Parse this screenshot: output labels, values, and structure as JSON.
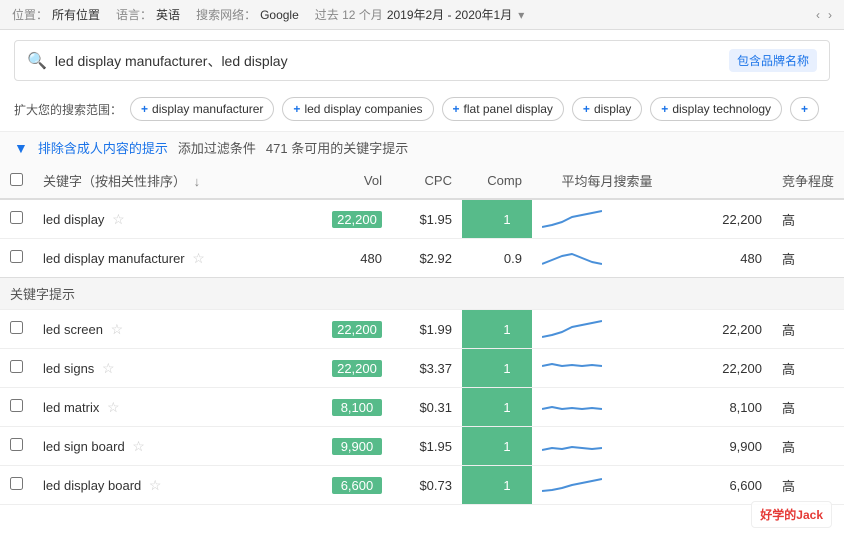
{
  "topbar": {
    "location_label": "位置：",
    "location_value": "所有位置",
    "language_label": "语言：",
    "language_value": "英语",
    "network_label": "搜索网络：",
    "network_value": "Google",
    "period_label": "过去 12 个月",
    "period_value": "2019年2月 - 2020年1月"
  },
  "searchbar": {
    "query": "led display manufacturer、led display",
    "brand_badge": "包含品牌名称"
  },
  "suggestions": {
    "label": "扩大您的搜索范围：",
    "tags": [
      "display manufacturer",
      "led display companies",
      "flat panel display",
      "display",
      "display technology"
    ]
  },
  "filterbar": {
    "exclude_link": "排除含成人内容的提示",
    "add_filter": "添加过滤条件",
    "count": "471 条可用的关键字提示"
  },
  "table": {
    "headers": {
      "checkbox": "",
      "keyword": "关键字（按相关性排序）",
      "vol": "Vol",
      "cpc": "CPC",
      "comp": "Comp",
      "trend": "平均每月搜索量",
      "monthly": "",
      "competition": "竞争程度"
    },
    "main_rows": [
      {
        "keyword": "led display",
        "vol": "22,200",
        "vol_green": true,
        "cpc": "$1.95",
        "comp": "1",
        "comp_green": true,
        "monthly": "22,200",
        "competition": "高",
        "trend_type": "up"
      },
      {
        "keyword": "led display manufacturer",
        "vol": "480",
        "vol_green": false,
        "cpc": "$2.92",
        "comp": "0.9",
        "comp_green": false,
        "monthly": "480",
        "competition": "高",
        "trend_type": "bump"
      }
    ],
    "section_label": "关键字提示",
    "suggestion_rows": [
      {
        "keyword": "led screen",
        "vol": "22,200",
        "vol_green": true,
        "cpc": "$1.99",
        "comp": "1",
        "comp_green": true,
        "monthly": "22,200",
        "competition": "高",
        "trend_type": "up"
      },
      {
        "keyword": "led signs",
        "vol": "22,200",
        "vol_green": true,
        "cpc": "$3.37",
        "comp": "1",
        "comp_green": true,
        "monthly": "22,200",
        "competition": "高",
        "trend_type": "flat_high"
      },
      {
        "keyword": "led matrix",
        "vol": "8,100",
        "vol_green": true,
        "cpc": "$0.31",
        "comp": "1",
        "comp_green": true,
        "monthly": "8,100",
        "competition": "高",
        "trend_type": "flat_mid"
      },
      {
        "keyword": "led sign board",
        "vol": "9,900",
        "vol_green": true,
        "cpc": "$1.95",
        "comp": "1",
        "comp_green": true,
        "monthly": "9,900",
        "competition": "高",
        "trend_type": "flat_mid2"
      },
      {
        "keyword": "led display board",
        "vol": "6,600",
        "vol_green": true,
        "cpc": "$0.73",
        "comp": "1",
        "comp_green": true,
        "monthly": "6,600",
        "competition": "高",
        "trend_type": "up2"
      }
    ]
  },
  "watermark": {
    "text": "好学的Jack"
  }
}
